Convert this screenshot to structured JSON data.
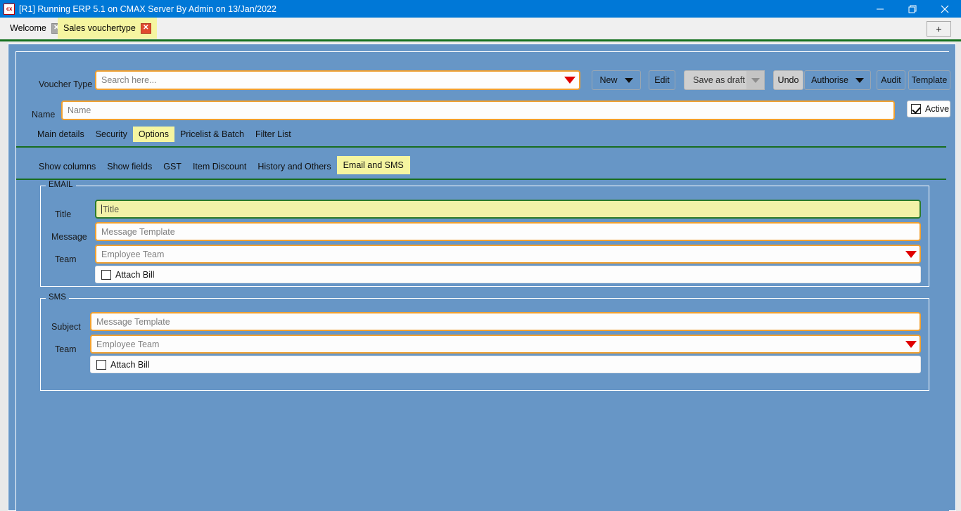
{
  "window": {
    "title": "[R1] Running ERP 5.1 on CMAX Server By Admin on 13/Jan/2022",
    "app_icon": "cx",
    "minimize": "—",
    "restore": "❐",
    "close": "✕"
  },
  "tabs": {
    "items": [
      {
        "label": "Welcome",
        "active": false,
        "close": "✕"
      },
      {
        "label": "Sales vouchertype",
        "active": true,
        "close": "✕"
      }
    ],
    "add_label": "+"
  },
  "toolbar": {
    "voucher_type_label": "Voucher Type",
    "search_placeholder": "Search here...",
    "search_value": "",
    "buttons": [
      {
        "label": "New",
        "has_caret": true,
        "state": "enabled"
      },
      {
        "label": "Edit",
        "has_caret": false,
        "state": "enabled"
      },
      {
        "label": "Save as draft",
        "has_caret": false,
        "state": "disabled"
      },
      {
        "label": "Undo",
        "has_caret": false,
        "state": "gray"
      },
      {
        "label": "Authorise",
        "has_caret": true,
        "state": "enabled"
      },
      {
        "label": "Audit",
        "has_caret": false,
        "state": "enabled"
      },
      {
        "label": "Template",
        "has_caret": false,
        "state": "enabled"
      }
    ]
  },
  "name_row": {
    "label": "Name",
    "placeholder": "Name",
    "value": "",
    "active_label": "Active",
    "active_checked": true
  },
  "main_tabs": {
    "items": [
      {
        "label": "Main details",
        "selected": false
      },
      {
        "label": "Security",
        "selected": false
      },
      {
        "label": "Options",
        "selected": true
      },
      {
        "label": "Pricelist & Batch",
        "selected": false
      },
      {
        "label": "Filter List",
        "selected": false
      }
    ]
  },
  "sub_tabs": {
    "items": [
      {
        "label": "Show columns",
        "selected": false
      },
      {
        "label": "Show fields",
        "selected": false
      },
      {
        "label": "GST",
        "selected": false
      },
      {
        "label": "Item Discount",
        "selected": false
      },
      {
        "label": "History and Others",
        "selected": false
      },
      {
        "label": "Email and SMS",
        "selected": true
      }
    ]
  },
  "email_group": {
    "title": "EMAIL",
    "title_label": "Title",
    "title_placeholder": "Title",
    "title_value": "",
    "message_label": "Message",
    "message_placeholder": "Message Template",
    "message_value": "",
    "team_label": "Team",
    "team_placeholder": "Employee Team",
    "team_value": "",
    "attach_label": "Attach Bill",
    "attach_checked": false
  },
  "sms_group": {
    "title": "SMS",
    "subject_label": "Subject",
    "subject_placeholder": "Message Template",
    "subject_value": "",
    "team_label": "Team",
    "team_placeholder": "Employee Team",
    "team_value": "",
    "attach_label": "Attach Bill",
    "attach_checked": false
  },
  "colors": {
    "titlebar": "#0078d7",
    "client_blue": "#6796c6",
    "accent_orange": "#f0a030",
    "focus_green": "#2b7a2b",
    "highlight_yellow": "#f5f5a0",
    "rule_green": "#14701e",
    "dropdown_red": "#e00000"
  }
}
